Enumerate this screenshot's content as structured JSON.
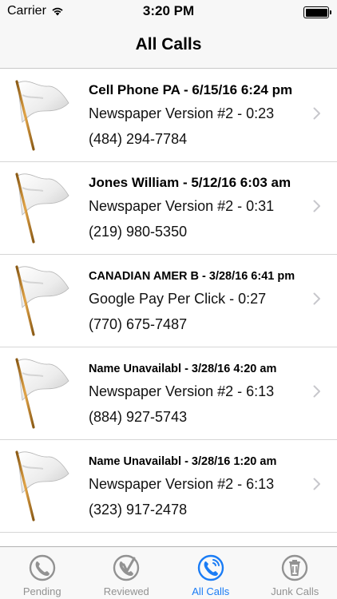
{
  "status_bar": {
    "carrier": "Carrier",
    "time": "3:20 PM"
  },
  "nav": {
    "title": "All Calls"
  },
  "calls": [
    {
      "title": "Cell Phone PA - 6/15/16 6:24 pm",
      "source": "Newspaper Version #2 - 0:23",
      "phone": "(484) 294-7784",
      "small": false
    },
    {
      "title": "Jones William - 5/12/16 6:03 am",
      "source": "Newspaper Version #2 - 0:31",
      "phone": "(219) 980-5350",
      "small": false
    },
    {
      "title": "CANADIAN AMER B - 3/28/16 6:41 pm",
      "source": "Google Pay Per Click - 0:27",
      "phone": "(770) 675-7487",
      "small": true
    },
    {
      "title": "Name Unavailabl - 3/28/16 4:20 am",
      "source": "Newspaper Version #2 - 6:13",
      "phone": "(884) 927-5743",
      "small": true
    },
    {
      "title": "Name Unavailabl - 3/28/16 1:20 am",
      "source": "Newspaper Version #2 - 6:13",
      "phone": "(323) 917-2478",
      "small": true
    }
  ],
  "tabs": [
    {
      "label": "Pending",
      "icon": "phone-pending-icon",
      "active": false
    },
    {
      "label": "Reviewed",
      "icon": "phone-reviewed-icon",
      "active": false
    },
    {
      "label": "All Calls",
      "icon": "phone-all-icon",
      "active": true
    },
    {
      "label": "Junk Calls",
      "icon": "trash-icon",
      "active": false
    }
  ],
  "colors": {
    "accent": "#1a7cf5",
    "inactive": "#929292"
  }
}
